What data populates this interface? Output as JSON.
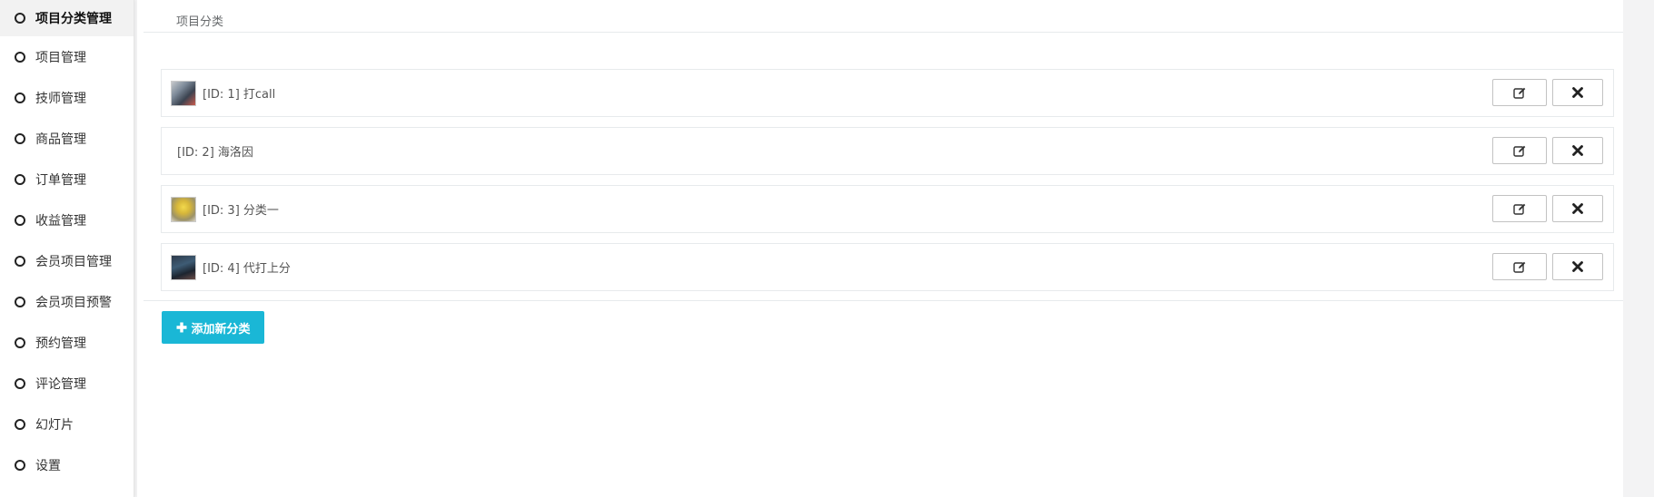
{
  "sidebar": {
    "items": [
      {
        "label": "项目分类管理",
        "active": true
      },
      {
        "label": "项目管理"
      },
      {
        "label": "技师管理"
      },
      {
        "label": "商品管理"
      },
      {
        "label": "订单管理"
      },
      {
        "label": "收益管理"
      },
      {
        "label": "会员项目管理"
      },
      {
        "label": "会员项目预警"
      },
      {
        "label": "预约管理"
      },
      {
        "label": "评论管理"
      },
      {
        "label": "幻灯片"
      },
      {
        "label": "设置"
      }
    ]
  },
  "main": {
    "tab_title": "项目分类",
    "categories": [
      {
        "label": "[ID: 1] 打call",
        "has_image": true
      },
      {
        "label": "[ID: 2] 海洛因",
        "has_image": false
      },
      {
        "label": "[ID: 3] 分类一",
        "has_image": true
      },
      {
        "label": "[ID: 4] 代打上分",
        "has_image": true
      }
    ],
    "add_button_label": "添加新分类"
  },
  "colors": {
    "accent": "#1ab7d6",
    "border": "#e7eaec",
    "active_nav_bg": "#f2f2f2"
  },
  "icons": {
    "nav": "circle-icon",
    "edit": "edit-icon",
    "delete": "close-icon",
    "add": "plus-icon"
  }
}
